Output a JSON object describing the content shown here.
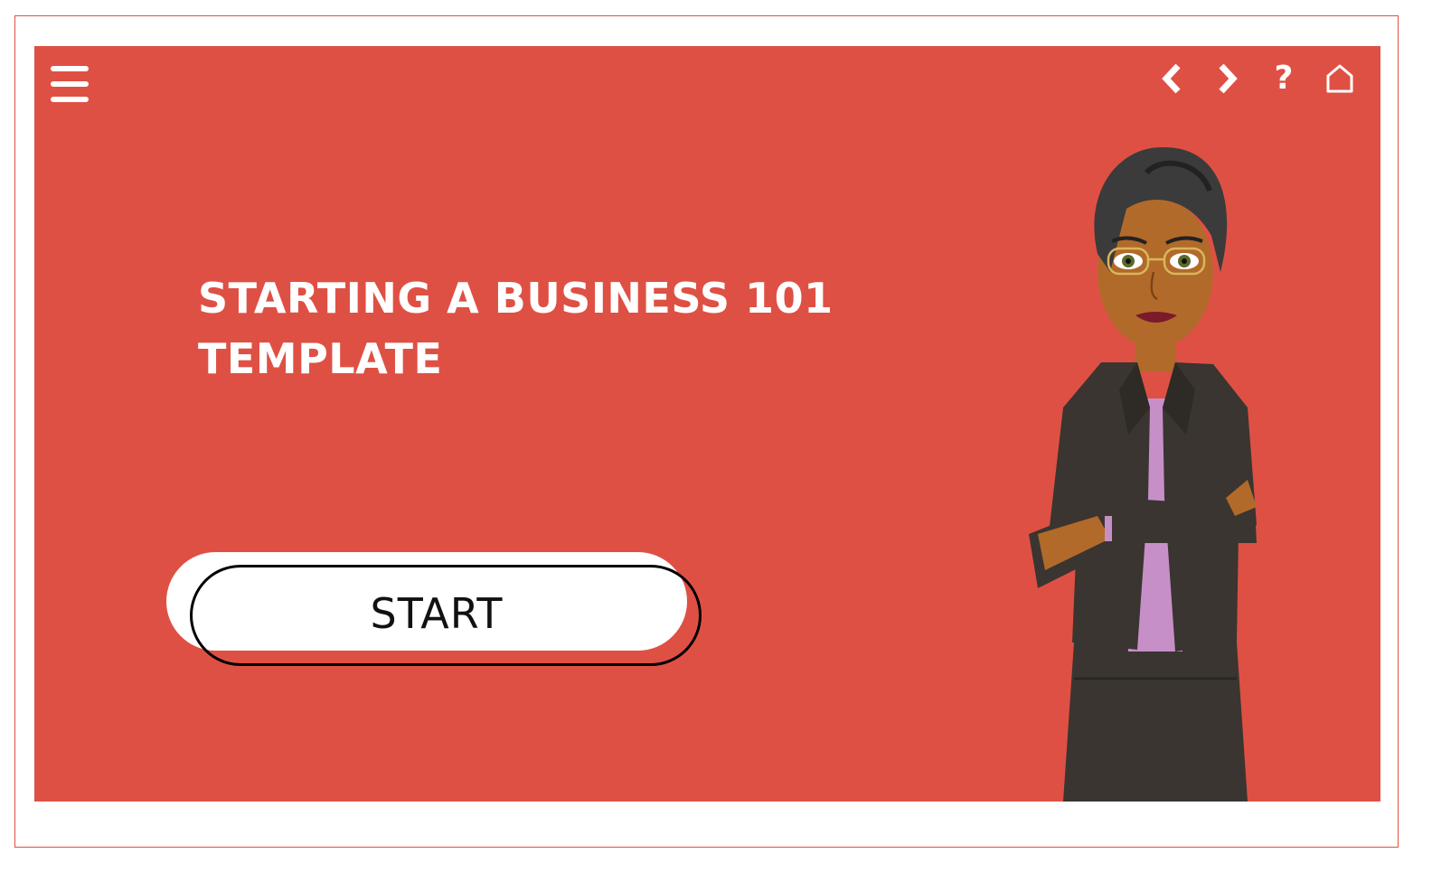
{
  "slide": {
    "title_line1": "STARTING A BUSINESS 101",
    "title_line2": "TEMPLATE",
    "start_label": "START"
  },
  "nav": {
    "icons": [
      "menu-icon",
      "chevron-left-icon",
      "chevron-right-icon",
      "help-icon",
      "home-icon"
    ],
    "help_glyph": "?"
  },
  "colors": {
    "background": "#df5044",
    "text": "#ffffff",
    "button": "#ffffff",
    "button_border": "#000000"
  }
}
